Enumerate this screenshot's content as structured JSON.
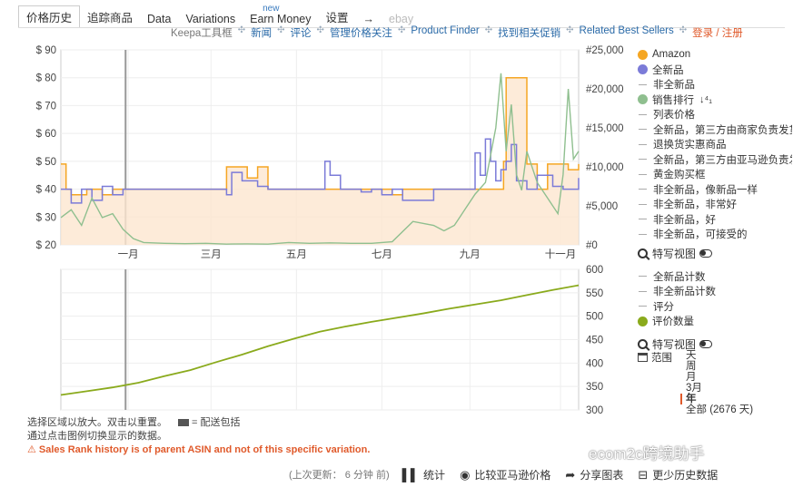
{
  "tabs": [
    {
      "label": "价格历史",
      "active": true
    },
    {
      "label": "追踪商品"
    },
    {
      "label": "Data"
    },
    {
      "label": "Variations"
    },
    {
      "label": "Earn Money",
      "badge": "new"
    },
    {
      "label": "设置"
    },
    {
      "label": "→"
    },
    {
      "label": "ebay",
      "muted": true
    }
  ],
  "links": [
    {
      "label": "Keepa工具框",
      "style": "grey"
    },
    {
      "label": "新闻"
    },
    {
      "label": "评论"
    },
    {
      "label": "管理价格关注"
    },
    {
      "label": "Product Finder"
    },
    {
      "label": "找到相关促销"
    },
    {
      "label": "Related Best Sellers"
    },
    {
      "label": "登录 / 注册",
      "style": "red"
    }
  ],
  "legend": [
    {
      "label": "Amazon",
      "color": "#f5a623",
      "type": "dot"
    },
    {
      "label": "全新品",
      "color": "#7b7bd8",
      "type": "dot"
    },
    {
      "label": "非全新品",
      "type": "dash"
    },
    {
      "label": "销售排行",
      "color": "#8fbf8f",
      "type": "dot",
      "sort": "↓⁴₁"
    },
    {
      "label": "列表价格",
      "type": "dash"
    },
    {
      "label": "全新品，第三方由商家负责发货",
      "type": "dash"
    },
    {
      "label": "退换货实惠商品",
      "type": "dash"
    },
    {
      "label": "全新品，第三方由亚马逊负责发货",
      "type": "dash"
    },
    {
      "label": "黄金购买框",
      "type": "dash"
    },
    {
      "label": "非全新品，像新品一样",
      "type": "dash"
    },
    {
      "label": "非全新品，非常好",
      "type": "dash"
    },
    {
      "label": "非全新品，好",
      "type": "dash"
    },
    {
      "label": "非全新品，可接受的",
      "type": "dash"
    }
  ],
  "zoom_view_label": "特写视图",
  "legend2": [
    {
      "label": "全新品计数",
      "type": "dash"
    },
    {
      "label": "非全新品计数",
      "type": "dash"
    },
    {
      "label": "评分",
      "type": "dash"
    },
    {
      "label": "评价数量",
      "color": "#8aaa1c",
      "type": "dot"
    }
  ],
  "zoom_view_label2": "特写视图",
  "range": {
    "label": "范围",
    "options": [
      "天",
      "周",
      "月",
      "3月",
      "年",
      "全部 (2676 天)"
    ],
    "selected": "年"
  },
  "notes": {
    "line1": "选择区域以放大。双击以重置。",
    "shipping": "= 配送包括",
    "line2": "通过点击图例切换显示的数据。",
    "warning": "⚠ Sales Rank history is of parent ASIN and not of this specific variation."
  },
  "bottom": {
    "updated": "(上次更新： 6 分钟 前)",
    "stats": "统计",
    "compare": "比较亚马逊价格",
    "share": "分享图表",
    "less": "更少历史数据"
  },
  "watermark": "ecom2c跨境助手",
  "chart_data": [
    {
      "type": "line",
      "x_ticks": [
        "一月",
        "三月",
        "五月",
        "七月",
        "九月",
        "十一月"
      ],
      "y_left": {
        "ticks": [
          "$ 90",
          "$ 80",
          "$ 70",
          "$ 60",
          "$ 50",
          "$ 40",
          "$ 30",
          "$ 20"
        ],
        "range": [
          20,
          90
        ]
      },
      "y_right": {
        "ticks": [
          "#25,000",
          "#20,000",
          "#15,000",
          "#10,000",
          "#5,000",
          "#0"
        ],
        "range": [
          0,
          25000
        ]
      },
      "series": [
        {
          "name": "Amazon",
          "color": "#f5a623",
          "x": [
            0.0,
            0.01,
            0.02,
            0.05,
            0.08,
            0.1,
            0.14,
            0.18,
            0.22,
            0.26,
            0.3,
            0.32,
            0.34,
            0.36,
            0.38,
            0.4,
            0.42,
            0.46,
            0.5,
            0.54,
            0.58,
            0.6,
            0.62,
            0.64,
            0.66,
            0.7,
            0.72,
            0.76,
            0.8,
            0.82,
            0.84,
            0.855,
            0.86,
            0.87,
            0.88,
            0.9,
            0.92,
            0.94,
            0.96,
            0.98,
            1.0
          ],
          "y": [
            49,
            40,
            38,
            40,
            38,
            40,
            40,
            40,
            40,
            40,
            40,
            48,
            48,
            44,
            48,
            40,
            40,
            40,
            40,
            40,
            40,
            40,
            40,
            38,
            40,
            40,
            40,
            40,
            40,
            40,
            40,
            50,
            80,
            80,
            80,
            49,
            40,
            49,
            49,
            47,
            49
          ]
        },
        {
          "name": "全新品",
          "color": "#7b7bd8",
          "x": [
            0.0,
            0.02,
            0.04,
            0.06,
            0.08,
            0.1,
            0.12,
            0.16,
            0.2,
            0.24,
            0.28,
            0.3,
            0.32,
            0.33,
            0.35,
            0.38,
            0.4,
            0.44,
            0.48,
            0.5,
            0.51,
            0.52,
            0.54,
            0.56,
            0.58,
            0.6,
            0.62,
            0.64,
            0.66,
            0.7,
            0.72,
            0.75,
            0.78,
            0.8,
            0.81,
            0.82,
            0.83,
            0.84,
            0.85,
            0.86,
            0.87,
            0.88,
            0.9,
            0.92,
            0.95,
            0.97,
            1.0
          ],
          "y": [
            40,
            35,
            40,
            36,
            41,
            38,
            40,
            40,
            40,
            40,
            40,
            40,
            38,
            46,
            43,
            41,
            40,
            40,
            40,
            40,
            50,
            45,
            40,
            40,
            39,
            40,
            38,
            40,
            36,
            36,
            40,
            40,
            40,
            53,
            45,
            58,
            50,
            43,
            47,
            50,
            56,
            43,
            40,
            45,
            41,
            40,
            44
          ]
        },
        {
          "name": "销售排行",
          "color": "#8fbf8f",
          "axis": "right",
          "x": [
            0.0,
            0.02,
            0.04,
            0.06,
            0.08,
            0.1,
            0.12,
            0.14,
            0.16,
            0.2,
            0.24,
            0.28,
            0.32,
            0.36,
            0.4,
            0.44,
            0.48,
            0.52,
            0.56,
            0.6,
            0.64,
            0.68,
            0.72,
            0.74,
            0.76,
            0.78,
            0.8,
            0.82,
            0.84,
            0.85,
            0.86,
            0.87,
            0.88,
            0.89,
            0.9,
            0.92,
            0.94,
            0.96,
            0.97,
            0.98,
            0.99,
            1.0
          ],
          "y": [
            3500,
            4500,
            2500,
            6000,
            3500,
            4000,
            2000,
            800,
            300,
            200,
            150,
            200,
            100,
            120,
            100,
            300,
            200,
            250,
            200,
            200,
            400,
            3000,
            2500,
            1800,
            2500,
            4500,
            6500,
            8000,
            15000,
            22000,
            12000,
            18000,
            9000,
            7000,
            12000,
            8000,
            6000,
            4000,
            9000,
            20000,
            11000,
            12000
          ]
        }
      ]
    },
    {
      "type": "line",
      "x_ticks": [
        "一月",
        "三月",
        "五月",
        "七月",
        "九月",
        "十一月"
      ],
      "y_right": {
        "ticks": [
          "600",
          "550",
          "500",
          "450",
          "400",
          "350",
          "300"
        ],
        "range": [
          300,
          600
        ]
      },
      "series": [
        {
          "name": "评价数量",
          "color": "#8aaa1c",
          "x": [
            0.0,
            0.05,
            0.1,
            0.15,
            0.2,
            0.25,
            0.3,
            0.35,
            0.4,
            0.45,
            0.5,
            0.55,
            0.6,
            0.65,
            0.7,
            0.75,
            0.8,
            0.85,
            0.9,
            0.95,
            1.0
          ],
          "y": [
            332,
            340,
            348,
            358,
            372,
            385,
            402,
            418,
            436,
            452,
            467,
            478,
            488,
            497,
            506,
            516,
            525,
            534,
            545,
            556,
            566
          ]
        }
      ]
    }
  ]
}
